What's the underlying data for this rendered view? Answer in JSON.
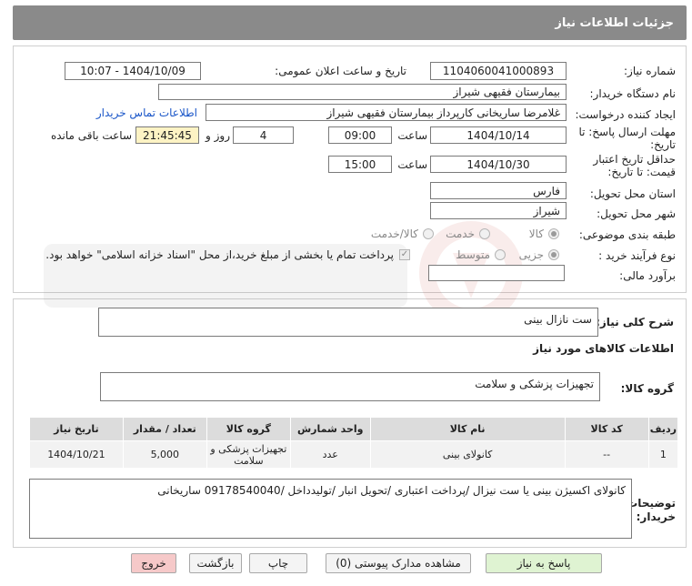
{
  "header": {
    "title": "جزئیات اطلاعات نیاز"
  },
  "form": {
    "need_number": {
      "label": "شماره نیاز:",
      "value": "1104060041000893"
    },
    "announce_datetime": {
      "label": "تاریخ و ساعت اعلان عمومی:",
      "value": "1404/10/09 - 10:07"
    },
    "buyer_org": {
      "label": "نام دستگاه خریدار:",
      "value": "بیمارستان فقیهی شیراز"
    },
    "requester": {
      "label": "ایجاد کننده درخواست:",
      "value": "غلامرضا ساریخانی کارپرداز بیمارستان فقیهی شیراز",
      "contact_link": "اطلاعات تماس خریدار"
    },
    "reply_deadline": {
      "label_line1": "مهلت ارسال پاسخ: تا",
      "label_line2": "تاریخ:",
      "date": "1404/10/14",
      "time_label": "ساعت",
      "time": "09:00",
      "days": "4",
      "days_label": "روز و",
      "remaining": "21:45:45",
      "remaining_label": "ساعت باقی مانده"
    },
    "price_validity": {
      "label_line1": "حداقل تاریخ اعتبار",
      "label_line2": "قیمت: تا تاریخ:",
      "date": "1404/10/30",
      "time_label": "ساعت",
      "time": "15:00"
    },
    "delivery_province": {
      "label": "استان محل تحویل:",
      "value": "فارس"
    },
    "delivery_city": {
      "label": "شهر محل تحویل:",
      "value": "شیراز"
    },
    "category": {
      "label": "طبقه بندی موضوعی:",
      "options": [
        "کالا",
        "خدمت",
        "کالا/خدمت"
      ],
      "selected": "کالا"
    },
    "purchase_process": {
      "label": "نوع فرآیند خرید :",
      "options": [
        "جزیی",
        "متوسط"
      ],
      "selected": "جزیی",
      "payment_note": "پرداخت تمام یا بخشی از مبلغ خرید،از محل \"اسناد خزانه اسلامی\" خواهد بود."
    },
    "financial_estimate": {
      "label": "برآورد مالی:",
      "value": ""
    }
  },
  "details": {
    "summary_label": "شرح کلی نیاز:",
    "summary_value": "ست نازال بینی",
    "goods_info_title": "اطلاعات کالاهای مورد نیاز",
    "goods_group_label": "گروه کالا:",
    "goods_group_value": "تجهیزات پزشکی و سلامت",
    "table": {
      "headers": [
        "ردیف",
        "کد کالا",
        "نام کالا",
        "واحد شمارش",
        "گروه کالا",
        "تعداد / مقدار",
        "تاریخ نیاز"
      ],
      "rows": [
        [
          "1",
          "--",
          "کانولای بینی",
          "عدد",
          "تجهیزات پزشکی و سلامت",
          "5,000",
          "1404/10/21"
        ]
      ]
    },
    "buyer_notes_label_line1": "توضیحات",
    "buyer_notes_label_line2": "خریدار:",
    "buyer_notes_value": "کانولای اکسیژن بینی یا ست نیزال /پرداخت اعتباری /تحویل انبار /تولیدداخل /09178540040 ساریخانی"
  },
  "buttons": {
    "reply": "پاسخ به نیاز",
    "attachments": "مشاهده مدارک پیوستی (0)",
    "print": "چاپ",
    "back": "بازگشت",
    "exit": "خروج"
  },
  "colors": {
    "header_bg": "#8a8a8a",
    "link": "#1a56c8",
    "remaining_bg": "#fdf3c4",
    "reply_btn": "#dff3d2",
    "exit_btn": "#f6c9c9"
  }
}
